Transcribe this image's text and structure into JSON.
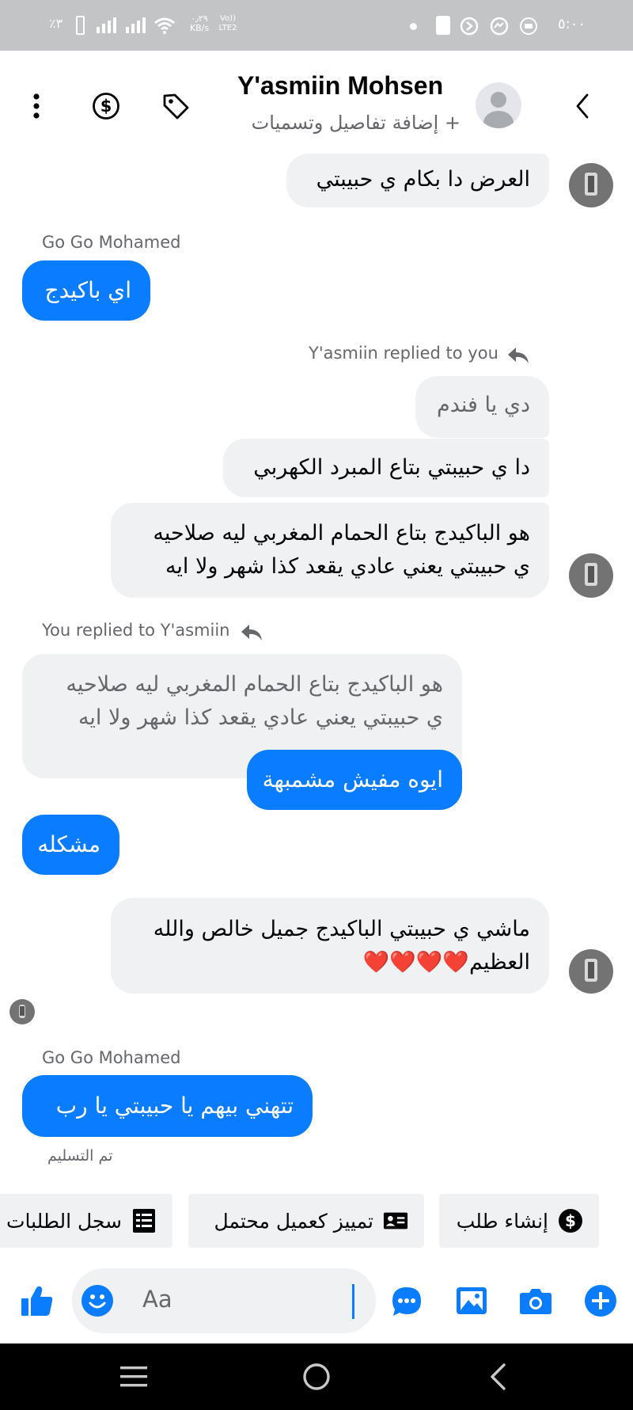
{
  "status_bar": {
    "time": "٥:٠٠",
    "left_text": "٪٣",
    "net_speed_value": "٠٫٢٩",
    "net_speed_unit": "KB/s",
    "volte_label": "Vo))",
    "lte_label": "LTE2"
  },
  "header": {
    "title": "Y'asmiin Mohsen",
    "subtitle": "+ إضافة تفاصيل وتسميات",
    "icons": [
      "more-vert-icon",
      "dollar-icon",
      "tag-icon",
      "avatar",
      "chevron-left-icon"
    ]
  },
  "messages": [
    {
      "type": "in",
      "text": "العرض دا بكام ي حبيبتي"
    },
    {
      "type": "sender_label",
      "text": "Go Go Mohamed"
    },
    {
      "type": "out",
      "text": "اي باكيدج"
    },
    {
      "type": "reply_label",
      "text": "Y'asmiin replied to you"
    },
    {
      "type": "quote",
      "text": "دي يا فندم"
    },
    {
      "type": "in",
      "text": "دا ي حبيبتي بتاع المبرد الكهربي"
    },
    {
      "type": "in",
      "lines": [
        "هو الباكيدج بتاع الحمام المغربي ليه صلاحيه",
        "ي حبيبتي يعني عادي يقعد كذا شهر ولا ايه"
      ]
    },
    {
      "type": "reply_label",
      "text": "You replied to Y'asmiin"
    },
    {
      "type": "quote",
      "lines": [
        "هو الباكيدج بتاع الحمام المغربي ليه صلاحيه",
        "ي حبيبتي يعني عادي يقعد كذا شهر ولا ايه"
      ]
    },
    {
      "type": "out",
      "text": "ايوه مفيش مشمبهة"
    },
    {
      "type": "out",
      "text": "مشكله"
    },
    {
      "type": "in",
      "lines": [
        "ماشي ي حبيبتي الباكيدج جميل خالص والله",
        "العظيم❤️❤️❤️❤️"
      ]
    },
    {
      "type": "sender_label",
      "text": "Go Go Mohamed"
    },
    {
      "type": "out",
      "text": "تتهني بيهم يا حبيبتي يا رب"
    },
    {
      "type": "status",
      "text": "تم التسليم"
    }
  ],
  "chips": {
    "create_order": "إنشاء طلب",
    "mark_customer": "تمييز كعميل محتمل",
    "orders_log": "سجل الطلبات"
  },
  "composer": {
    "placeholder": "Aa",
    "icons": [
      "plus-icon",
      "camera-icon",
      "gallery-icon",
      "chat-icon",
      "emoji-icon",
      "like-icon"
    ]
  },
  "nav": {
    "icons": [
      "recents-icon",
      "home-icon",
      "back-icon"
    ]
  },
  "colors": {
    "accent": "#0a7cff",
    "bubble_in": "#f0f1f3",
    "status_bar": "#c3c4c6",
    "nav_bar": "#000000"
  }
}
